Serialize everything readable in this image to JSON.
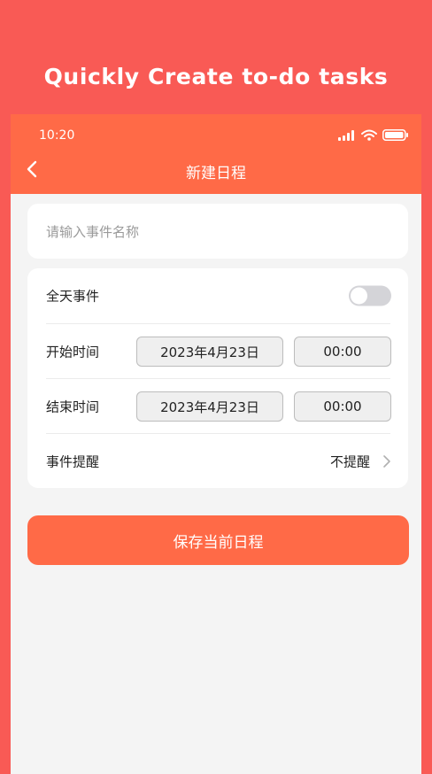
{
  "promo": {
    "title": "Quickly Create to-do tasks"
  },
  "status_bar": {
    "time": "10:20"
  },
  "nav": {
    "title": "新建日程"
  },
  "event_name": {
    "placeholder": "请输入事件名称",
    "value": ""
  },
  "form": {
    "all_day": {
      "label": "全天事件",
      "enabled": false
    },
    "start": {
      "label": "开始时间",
      "date": "2023年4月23日",
      "time": "00:00"
    },
    "end": {
      "label": "结束时间",
      "date": "2023年4月23日",
      "time": "00:00"
    },
    "reminder": {
      "label": "事件提醒",
      "value": "不提醒"
    }
  },
  "save_button": {
    "label": "保存当前日程"
  },
  "colors": {
    "background": "#f95a55",
    "accent": "#ff6a47",
    "page": "#f4f4f4"
  },
  "icons": [
    "signal-icon",
    "wifi-icon",
    "battery-icon",
    "back-arrow-icon",
    "chevron-right-icon"
  ]
}
